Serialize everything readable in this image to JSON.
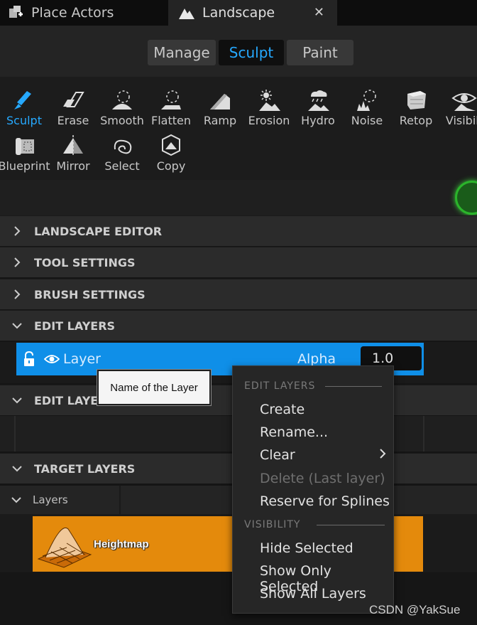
{
  "tabs": [
    {
      "label": "Place Actors",
      "icon": "place-actors-icon"
    },
    {
      "label": "Landscape",
      "icon": "landscape-icon",
      "close": "✕"
    }
  ],
  "modes": [
    {
      "label": "Manage"
    },
    {
      "label": "Sculpt",
      "active": true
    },
    {
      "label": "Paint"
    }
  ],
  "tools": [
    {
      "label": "Sculpt",
      "icon": "sculpt-icon",
      "active": true
    },
    {
      "label": "Erase",
      "icon": "erase-icon"
    },
    {
      "label": "Smooth",
      "icon": "smooth-icon"
    },
    {
      "label": "Flatten",
      "icon": "flatten-icon"
    },
    {
      "label": "Ramp",
      "icon": "ramp-icon"
    },
    {
      "label": "Erosion",
      "icon": "erosion-icon"
    },
    {
      "label": "Hydro",
      "icon": "hydro-icon"
    },
    {
      "label": "Noise",
      "icon": "noise-icon"
    },
    {
      "label": "Retop",
      "icon": "retop-icon"
    },
    {
      "label": "Visibili",
      "icon": "visibility-icon"
    },
    {
      "label": "Blueprint",
      "icon": "blueprint-icon"
    },
    {
      "label": "Mirror",
      "icon": "mirror-icon"
    },
    {
      "label": "Select",
      "icon": "select-icon"
    },
    {
      "label": "Copy",
      "icon": "copy-icon"
    }
  ],
  "sections": {
    "landscape_editor": "LANDSCAPE EDITOR",
    "tool_settings": "TOOL SETTINGS",
    "brush_settings": "BRUSH SETTINGS",
    "edit_layers": "EDIT LAYERS",
    "edit_layer_blends": "EDIT LAYER",
    "target_layers": "TARGET LAYERS"
  },
  "edit_layer": {
    "name": "Layer",
    "alpha_label": "Alpha",
    "alpha_value": "1.0"
  },
  "tooltip": "Name of the Layer",
  "target": {
    "layers_label": "Layers",
    "heightmap_label": "Heightmap"
  },
  "context_menu": {
    "edit_layers_heading": "EDIT LAYERS",
    "items": [
      "Create",
      "Rename...",
      "Clear",
      "Delete (Last layer)",
      "Reserve for Splines"
    ],
    "visibility_heading": "VISIBILITY",
    "visibility_items": [
      "Hide Selected",
      "Show Only Selected",
      "Show All Layers"
    ]
  },
  "watermark": "CSDN @YakSue",
  "colors": {
    "accent": "#26a9ff",
    "selected_layer": "#0f8fe8",
    "heightmap": "#e48a0c"
  }
}
